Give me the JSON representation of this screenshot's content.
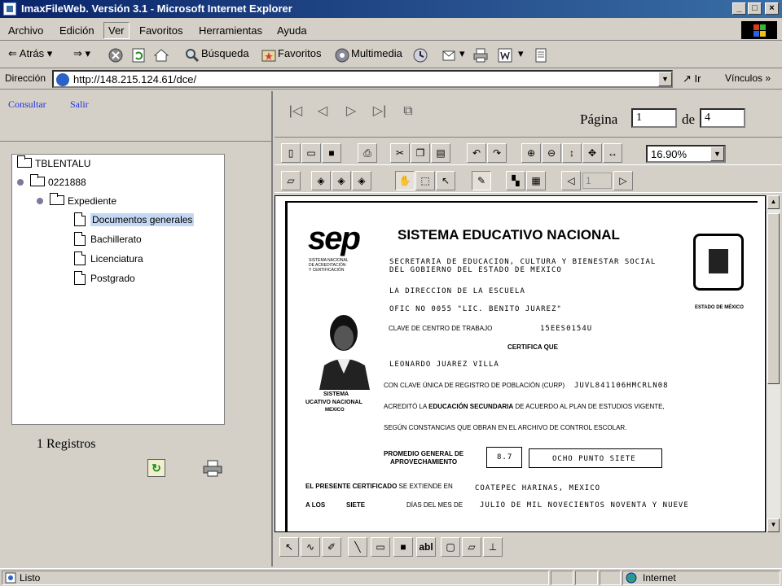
{
  "window": {
    "title": "ImaxFileWeb. Versión 3.1 - Microsoft Internet Explorer",
    "minimize": "_",
    "maximize": "□",
    "close": "×"
  },
  "menu": [
    "Archivo",
    "Edición",
    "Ver",
    "Favoritos",
    "Herramientas",
    "Ayuda"
  ],
  "toolbar": {
    "back": "Atrás",
    "search": "Búsqueda",
    "favorites": "Favoritos",
    "media": "Multimedia"
  },
  "address": {
    "label": "Dirección",
    "url": "http://148.215.124.61/dce/",
    "go": "Ir",
    "links": "Vínculos"
  },
  "left": {
    "links": [
      "Consultar",
      "Salir"
    ],
    "tree": {
      "root": "TBLENTALU",
      "record": "0221888",
      "folder": "Expediente",
      "docs": [
        "Documentos generales",
        "Bachillerato",
        "Licenciatura",
        "Postgrado"
      ],
      "selected_index": 0
    },
    "records": "1 Registros"
  },
  "viewer": {
    "page_label": "Página",
    "page_current": "1",
    "of_label": "de",
    "page_total": "4",
    "zoom": "16.90%",
    "page_box": "1"
  },
  "certificate": {
    "logo": "sep",
    "logo_sub1": "SISTEMA NACIONAL",
    "logo_sub2": "DE ACREDITACIÓN",
    "logo_sub3": "Y CERTIFICACIÓN",
    "header": "SISTEMA EDUCATIVO NACIONAL",
    "line1": "SECRETARIA DE EDUCACION, CULTURA Y BIENESTAR SOCIAL",
    "line2": "DEL GOBIERNO DEL ESTADO DE MEXICO",
    "state": "ESTADO DE MÉXICO",
    "line3": "LA DIRECCION DE LA ESCUELA",
    "line4": "OFIC NO 0055 \"LIC. BENITO JUAREZ\"",
    "cct_label": "CLAVE DE CENTRO DE TRABAJO",
    "cct": "15EES0154U",
    "certifica": "CERTIFICA QUE",
    "name": "LEONARDO JUAREZ VILLA",
    "curp_label": "CON CLAVE ÚNICA DE REGISTRO DE POBLACIÓN (CURP)",
    "curp": "JUVL841106HMCRLN08",
    "acredito_pre": "ACREDITÓ LA",
    "acredito_bold": "EDUCACIÓN SECUNDARIA",
    "acredito_post": "DE ACUERDO AL PLAN DE ESTUDIOS VIGENTE,",
    "segun": "SEGÚN CONSTANCIAS QUE OBRAN EN EL ARCHIVO DE CONTROL ESCOLAR.",
    "stamp1": "SISTEMA",
    "stamp2": "UCATIVO NACIONAL",
    "stamp3": "MEXICO",
    "promedio1": "PROMEDIO GENERAL DE",
    "promedio2": "APROVECHAMIENTO",
    "grade": "8.7",
    "grade_words": "OCHO PUNTO SIETE",
    "presente_bold": "EL PRESENTE CERTIFICADO",
    "presente_rest": "SE EXTIENDE EN",
    "place": "COATEPEC HARINAS, MEXICO",
    "alos": "A LOS",
    "siete": "SIETE",
    "dias": "DÍAS DEL MES DE",
    "date": "JULIO DE MIL NOVECIENTOS NOVENTA Y NUEVE"
  },
  "annotation": {
    "text_tool": "abl"
  },
  "status": {
    "left": "Listo",
    "zone": "Internet"
  }
}
